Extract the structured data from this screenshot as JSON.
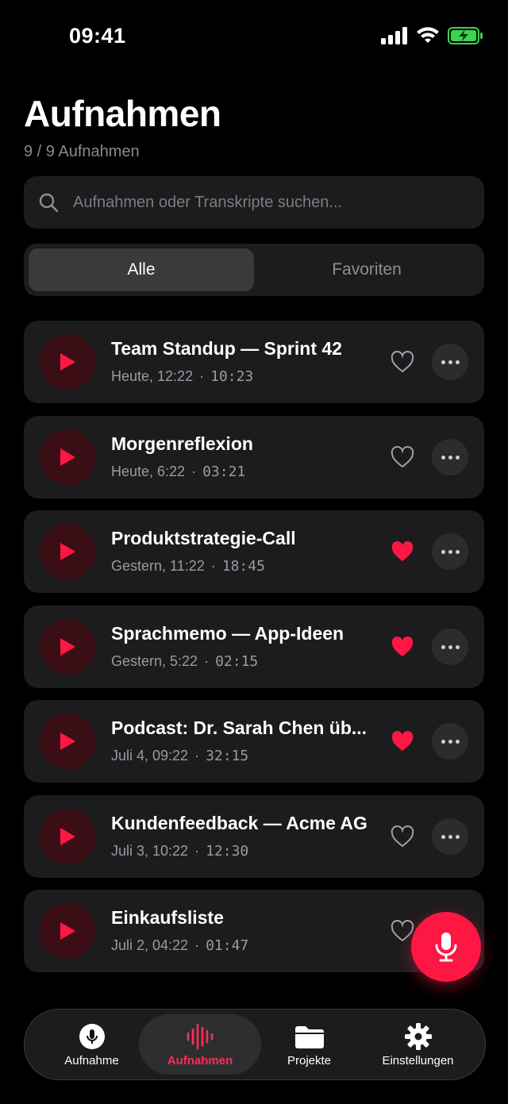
{
  "status": {
    "time": "09:41"
  },
  "header": {
    "title": "Aufnahmen",
    "subtitle": "9 / 9 Aufnahmen"
  },
  "search": {
    "placeholder": "Aufnahmen oder Transkripte suchen..."
  },
  "filter": {
    "all_label": "Alle",
    "favorites_label": "Favoriten"
  },
  "colors": {
    "accent": "#ff1744",
    "row_bg": "#1c1c1e",
    "play_bg": "#3b0d14"
  },
  "recordings": [
    {
      "title": "Team Standup — Sprint 42",
      "date": "Heute, 12:22",
      "duration": "10:23",
      "favorite": false
    },
    {
      "title": "Morgenreflexion",
      "date": "Heute, 6:22",
      "duration": "03:21",
      "favorite": false
    },
    {
      "title": "Produktstrategie-Call",
      "date": "Gestern, 11:22",
      "duration": "18:45",
      "favorite": true
    },
    {
      "title": "Sprachmemo — App-Ideen",
      "date": "Gestern, 5:22",
      "duration": "02:15",
      "favorite": true
    },
    {
      "title": "Podcast: Dr. Sarah Chen üb...",
      "date": "Juli 4, 09:22",
      "duration": "32:15",
      "favorite": true
    },
    {
      "title": "Kundenfeedback — Acme AG",
      "date": "Juli 3, 10:22",
      "duration": "12:30",
      "favorite": false
    },
    {
      "title": "Einkaufsliste",
      "date": "Juli 2, 04:22",
      "duration": "01:47",
      "favorite": false
    }
  ],
  "tabbar": {
    "tabs": [
      {
        "label": "Aufnahme",
        "icon": "microphone-icon"
      },
      {
        "label": "Aufnahmen",
        "icon": "waveform-icon"
      },
      {
        "label": "Projekte",
        "icon": "folder-icon"
      },
      {
        "label": "Einstellungen",
        "icon": "gear-icon"
      }
    ]
  }
}
